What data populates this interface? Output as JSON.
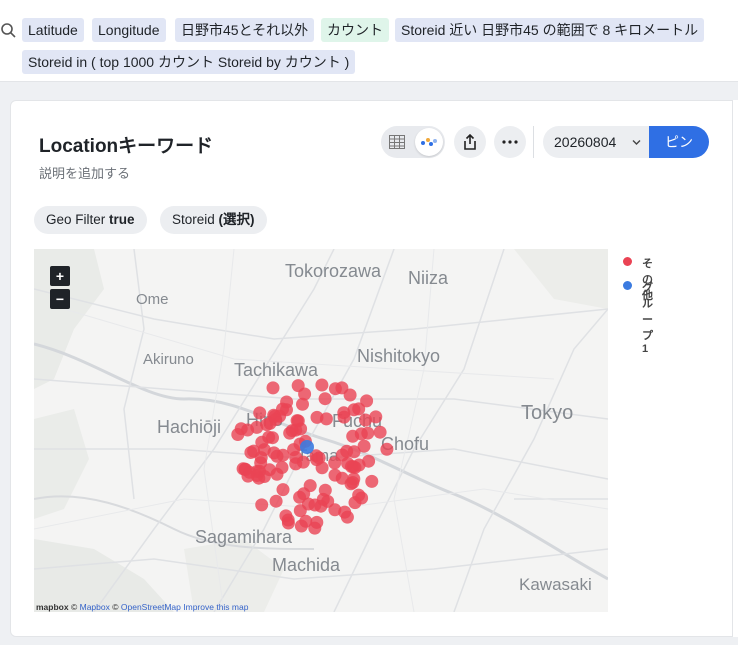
{
  "query": {
    "search_icon": "search-icon",
    "chips": [
      {
        "label": "Latitude",
        "color": "#e1e6f5"
      },
      {
        "label": "Longitude",
        "color": "#e1e6f5"
      },
      {
        "label": "日野市45とそれ以外",
        "color": "#e1e6f5"
      },
      {
        "label": "カウント",
        "color": "#dff5ea"
      },
      {
        "label": "Storeid 近い 日野市45 の範囲で 8 キロメートル",
        "color": "#e1e6f5"
      },
      {
        "label": "Storeid in ( top 1000 カウント Storeid by カウント )",
        "color": "#e1e6f5"
      }
    ]
  },
  "card": {
    "title": "Locationキーワード",
    "description": "説明を追加する",
    "view_toggle": {
      "table_icon": "table-icon",
      "map_icon": "map-chart-icon",
      "active": "map"
    },
    "share_icon": "share-icon",
    "more_icon": "more-icon",
    "date": "20260804",
    "pin_label": "ピン",
    "accent": "#2f6fe4"
  },
  "filters": [
    {
      "prefix": "Geo Filter",
      "value": "true"
    },
    {
      "prefix": "Storeid",
      "value": "(選択)"
    }
  ],
  "map": {
    "zoom_in": "+",
    "zoom_out": "−",
    "places": [
      "Tokorozawa",
      "Niiza",
      "Ome",
      "Akiruno",
      "Tachikawa",
      "Nishitokyo",
      "Hachiōji",
      "Hino",
      "Fuchu",
      "Chofu",
      "Tokyo",
      "Tama",
      "Sagamihara",
      "Machida",
      "Kawasaki"
    ],
    "attribution": {
      "logo": "mapbox",
      "c1": "©",
      "mapbox": "Mapbox",
      "c2": "©",
      "osm": "OpenStreetMap",
      "improve": "Improve this map"
    }
  },
  "legend": [
    {
      "label": "その他",
      "color": "#ea4354"
    },
    {
      "label": "グループ 1",
      "color": "#3b7be0"
    }
  ],
  "points": {
    "red_count": 120,
    "blue_count": 1,
    "red_color": "#ea4354",
    "blue_color": "#3b7be0"
  }
}
